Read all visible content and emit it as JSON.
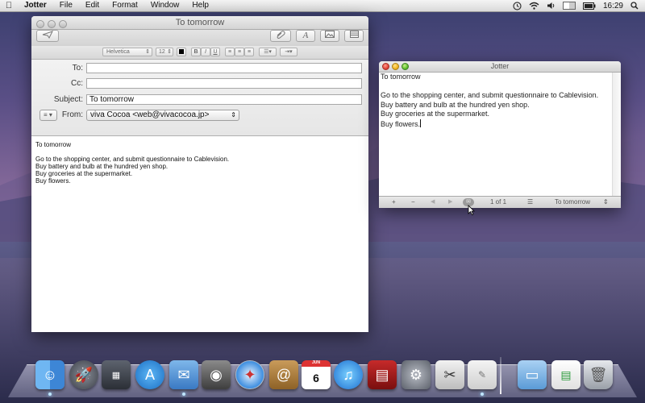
{
  "menubar": {
    "app_name": "Jotter",
    "items": [
      "File",
      "Edit",
      "Format",
      "Window",
      "Help"
    ],
    "clock": "16:29"
  },
  "mail": {
    "window_title": "To tomorrow",
    "toolbar": {
      "font_name": "Helvetica",
      "font_size": "12",
      "bold": "B",
      "italic": "I",
      "underline": "U",
      "font_button": "A"
    },
    "header": {
      "to_label": "To:",
      "to_value": "",
      "cc_label": "Cc:",
      "cc_value": "",
      "subject_label": "Subject:",
      "subject_value": "To tomorrow",
      "from_label": "From:",
      "from_value": "viva Cocoa <web@vivacocoa.jp>"
    },
    "body_lines": [
      "To tomorrow",
      "",
      "Go to the shopping center, and submit questionnaire to Cablevision.",
      "Buy battery and bulb at the hundred yen shop.",
      "Buy groceries at the supermarket.",
      "Buy flowers."
    ]
  },
  "jotter": {
    "window_title": "Jotter",
    "body_lines": [
      "To tomorrow",
      "",
      "Go to the shopping center, and submit questionnaire to Cablevision.",
      "Buy battery and bulb at the hundred yen shop.",
      "Buy groceries at the supermarket.",
      "Buy flowers."
    ],
    "bottom": {
      "add": "+",
      "remove": "−",
      "prev": "◀",
      "next": "▶",
      "page_indicator": "1 of 1",
      "note_selector": "To tomorrow"
    }
  },
  "dock": {
    "apps": [
      "finder",
      "launchpad",
      "mission-control",
      "app-store",
      "mail",
      "facetime",
      "safari",
      "contacts",
      "calendar",
      "itunes",
      "photo-booth",
      "system-preferences",
      "preview",
      "jotter",
      "applications-folder",
      "documents",
      "trash"
    ],
    "calendar_day": "6",
    "calendar_month": "JUN"
  }
}
